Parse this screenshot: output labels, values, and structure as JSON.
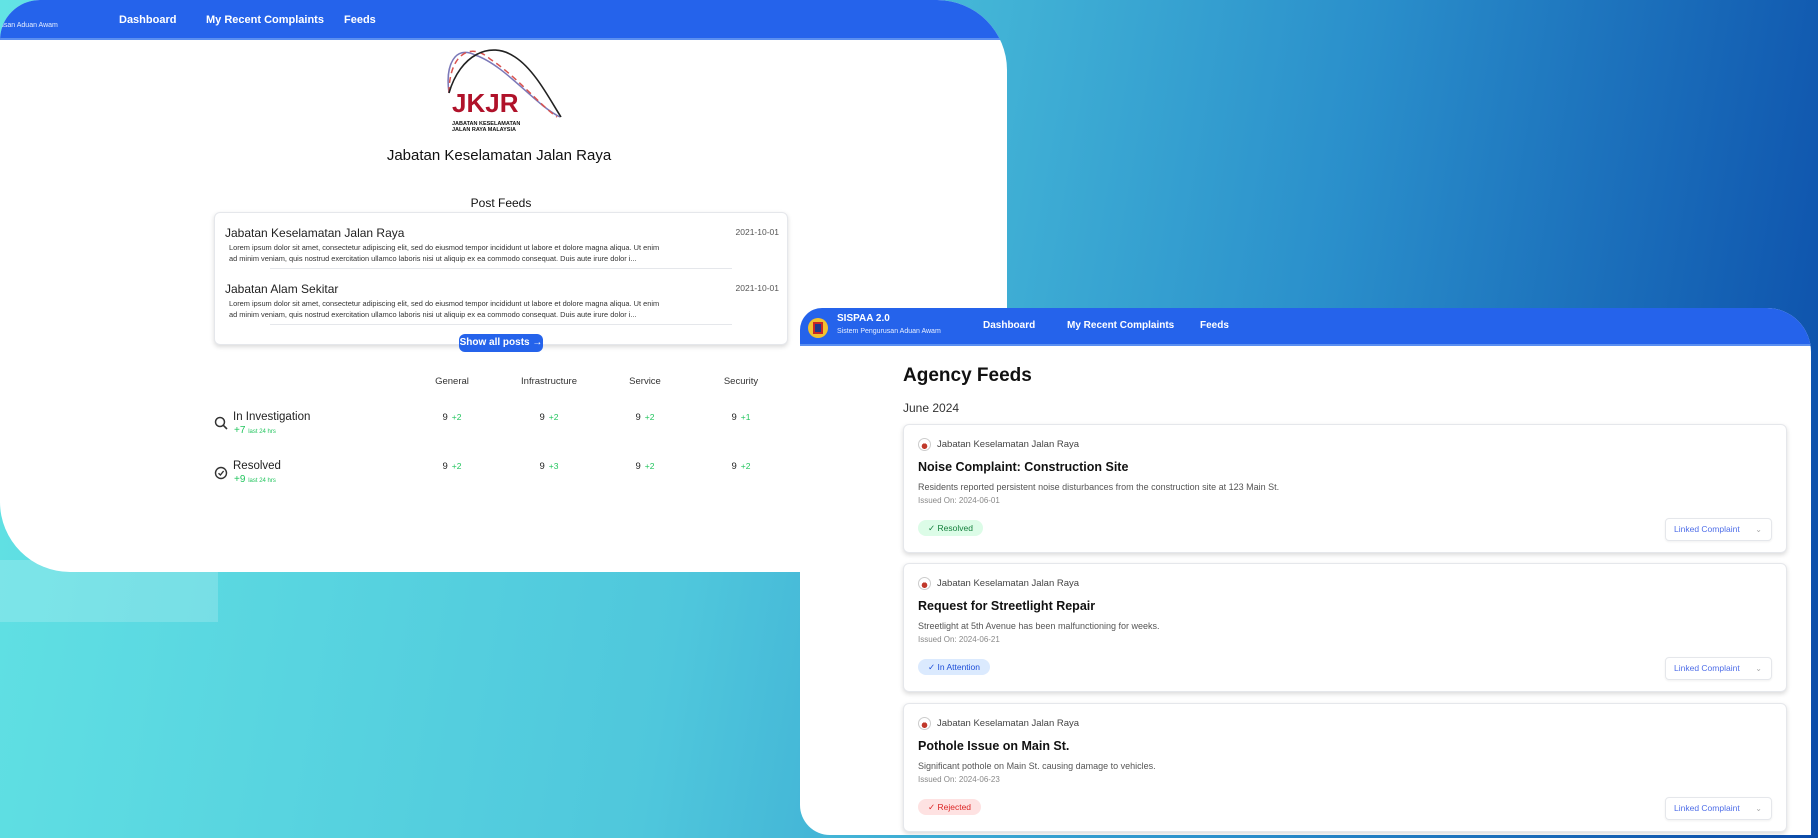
{
  "left_window": {
    "nav": {
      "brand_partial": "usan Aduan Awam",
      "links": [
        "Dashboard",
        "My Recent Complaints",
        "Feeds"
      ]
    },
    "logo": {
      "text": "JKJR",
      "subtext": "JABATAN KESELAMATAN JALAN RAYA MALAYSIA",
      "color": "#b0122a"
    },
    "agency_name": "Jabatan Keselamatan Jalan Raya",
    "post_feeds": {
      "title": "Post Feeds",
      "posts": [
        {
          "agency": "Jabatan Keselamatan Jalan Raya",
          "date": "2021-10-01",
          "body": "Lorem ipsum dolor sit amet, consectetur adipiscing elit, sed do eiusmod tempor incididunt ut labore et dolore magna aliqua. Ut enim ad minim veniam, quis nostrud exercitation ullamco laboris nisi ut aliquip ex ea commodo consequat. Duis aute irure dolor i..."
        },
        {
          "agency": "Jabatan Alam Sekitar",
          "date": "2021-10-01",
          "body": "Lorem ipsum dolor sit amet, consectetur adipiscing elit, sed do eiusmod tempor incididunt ut labore et dolore magna aliqua. Ut enim ad minim veniam, quis nostrud exercitation ullamco laboris nisi ut aliquip ex ea commodo consequat. Duis aute irure dolor i..."
        }
      ],
      "show_all": "Show all posts →"
    },
    "stats": {
      "columns": [
        "General",
        "Infrastructure",
        "Service",
        "Security"
      ],
      "rows": [
        {
          "label": "In Investigation",
          "icon": "search-icon",
          "delta": "+7",
          "delta_label": "last 24 hrs",
          "cells": [
            {
              "v": "9",
              "d": "+2"
            },
            {
              "v": "9",
              "d": "+2"
            },
            {
              "v": "9",
              "d": "+2"
            },
            {
              "v": "9",
              "d": "+1"
            }
          ]
        },
        {
          "label": "Resolved",
          "icon": "check-circle-icon",
          "delta": "+9",
          "delta_label": "last 24 hrs",
          "cells": [
            {
              "v": "9",
              "d": "+2"
            },
            {
              "v": "9",
              "d": "+3"
            },
            {
              "v": "9",
              "d": "+2"
            },
            {
              "v": "9",
              "d": "+2"
            }
          ]
        }
      ]
    }
  },
  "right_window": {
    "nav": {
      "brand": "SISPAA 2.0",
      "brand_sub": "Sistem Pengurusan Aduan Awam",
      "links": [
        "Dashboard",
        "My Recent Complaints",
        "Feeds"
      ]
    },
    "title": "Agency Feeds",
    "month": "June 2024",
    "feeds": [
      {
        "agency": "Jabatan Keselamatan Jalan Raya",
        "title": "Noise Complaint: Construction Site",
        "desc": "Residents reported persistent noise disturbances from the construction site at 123 Main St.",
        "issued": "Issued On: 2024-06-01",
        "status": "✓  Resolved",
        "status_bg": "#dcfce7",
        "status_fg": "#15803d",
        "action": "Linked Complaint"
      },
      {
        "agency": "Jabatan Keselamatan Jalan Raya",
        "title": "Request for Streetlight Repair",
        "desc": "Streetlight at 5th Avenue has been malfunctioning for weeks.",
        "issued": "Issued On: 2024-06-21",
        "status": "✓  In Attention",
        "status_bg": "#dbeafe",
        "status_fg": "#1d4ed8",
        "action": "Linked Complaint"
      },
      {
        "agency": "Jabatan Keselamatan Jalan Raya",
        "title": "Pothole Issue on Main St.",
        "desc": "Significant pothole on Main St. causing damage to vehicles.",
        "issued": "Issued On: 2024-06-23",
        "status": "✓  Rejected",
        "status_bg": "#fee2e2",
        "status_fg": "#dc2626",
        "action": "Linked Complaint"
      }
    ]
  },
  "colors": {
    "nav": "#2563eb",
    "positive": "#22c55e"
  }
}
